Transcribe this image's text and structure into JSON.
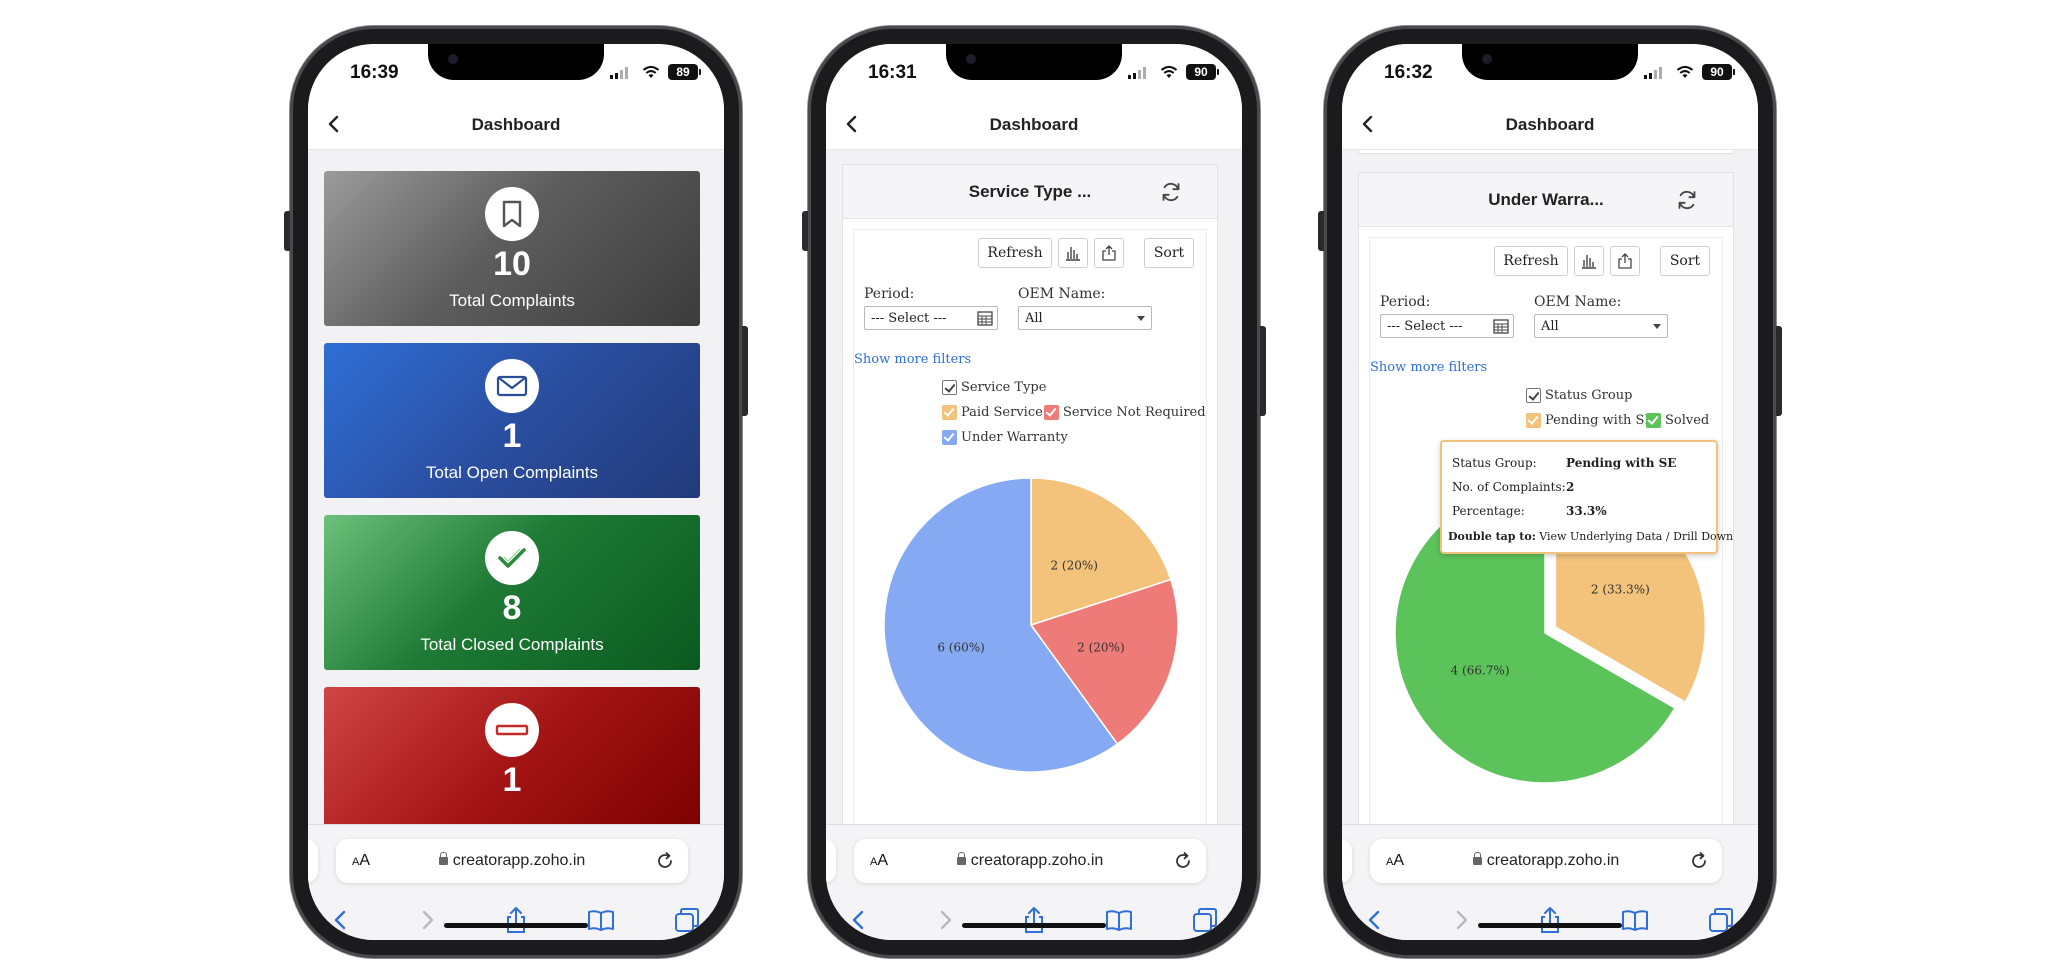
{
  "colors": {
    "accent": "#2f6fd6",
    "paid_service": "#f3c27b",
    "service_not_required": "#ef7b78",
    "under_warranty": "#85aaf3",
    "pending_with_se": "#f3c27b",
    "solved": "#5cc35b"
  },
  "phones": [
    {
      "time": "16:39",
      "battery": "89",
      "nav_title": "Dashboard",
      "cards": [
        {
          "value": "10",
          "label": "Total Complaints",
          "icon": "bookmark-icon"
        },
        {
          "value": "1",
          "label": "Total Open Complaints",
          "icon": "mail-icon"
        },
        {
          "value": "8",
          "label": "Total Closed Complaints",
          "icon": "check-icon"
        },
        {
          "value": "1",
          "label": "",
          "icon": "minus-icon"
        }
      ],
      "url": "creatorapp.zoho.in",
      "aa": "AA"
    },
    {
      "time": "16:31",
      "battery": "90",
      "nav_title": "Dashboard",
      "report_title": "Service Type ...",
      "toolbar": {
        "refresh": "Refresh",
        "sort": "Sort"
      },
      "filters": {
        "period_label": "Period:",
        "period_value": "--- Select ---",
        "oem_label": "OEM Name:",
        "oem_value": "All",
        "more": "Show more filters"
      },
      "legend": {
        "group": "Service Type",
        "items": [
          "Paid Service",
          "Service Not Required",
          "Under Warranty"
        ]
      },
      "url": "creatorapp.zoho.in",
      "aa": "AA"
    },
    {
      "time": "16:32",
      "battery": "90",
      "nav_title": "Dashboard",
      "report_title": "Under Warra...",
      "toolbar": {
        "refresh": "Refresh",
        "sort": "Sort"
      },
      "filters": {
        "period_label": "Period:",
        "period_value": "--- Select ---",
        "oem_label": "OEM Name:",
        "oem_value": "All",
        "more": "Show more filters"
      },
      "legend": {
        "group": "Status Group",
        "items": [
          "Pending with SE",
          "Solved"
        ]
      },
      "tooltip": {
        "k1": "Status Group:",
        "v1": "Pending with SE",
        "k2": "No. of Complaints:",
        "v2": "2",
        "k3": "Percentage:",
        "v3": "33.3%",
        "hint_bold": "Double tap to:",
        "hint": "View Underlying Data / Drill Down"
      },
      "url": "creatorapp.zoho.in",
      "aa": "AA"
    }
  ],
  "chart_data": [
    {
      "type": "pie",
      "title": "Service Type ...",
      "categories": [
        "Paid Service",
        "Service Not Required",
        "Under Warranty"
      ],
      "values": [
        2,
        2,
        6
      ],
      "data_labels": [
        "2 (20%)",
        "2 (20%)",
        "6 (60%)"
      ],
      "legend_title": "Service Type",
      "legend_position": "top"
    },
    {
      "type": "pie",
      "title": "Under Warra...",
      "categories": [
        "Pending with SE",
        "Solved"
      ],
      "values": [
        2,
        4
      ],
      "data_labels": [
        "2 (33.3%)",
        "4 (66.7%)"
      ],
      "legend_title": "Status Group",
      "legend_position": "top",
      "exploded": "Pending with SE"
    }
  ]
}
